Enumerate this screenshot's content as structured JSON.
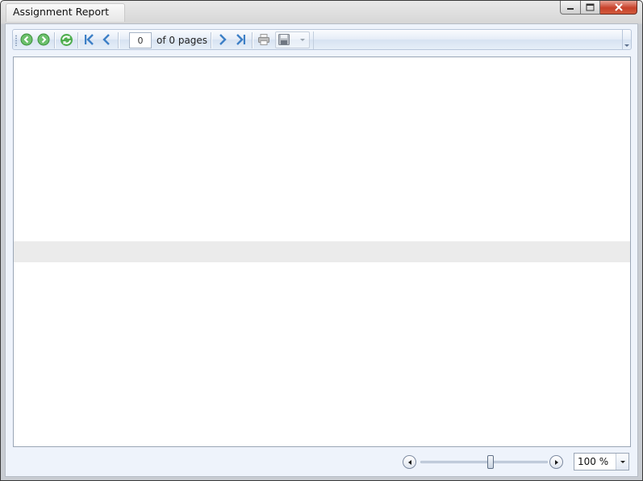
{
  "window": {
    "title": "Assignment Report"
  },
  "toolbar": {
    "buttons": [
      {
        "name": "back",
        "icon": "arrow-left-icon"
      },
      {
        "name": "forward",
        "icon": "arrow-right-icon"
      },
      {
        "name": "refresh",
        "icon": "refresh-icon"
      },
      {
        "name": "first-page",
        "icon": "first-page-icon"
      },
      {
        "name": "previous-page",
        "icon": "chevron-left-icon"
      },
      {
        "name": "next-page",
        "icon": "chevron-right-icon"
      },
      {
        "name": "last-page",
        "icon": "last-page-icon"
      },
      {
        "name": "print",
        "icon": "printer-icon"
      },
      {
        "name": "save",
        "icon": "floppy-disk-icon"
      }
    ],
    "page_input_value": "0",
    "page_of_text": "of 0 pages"
  },
  "zoom": {
    "value_text": "100 %",
    "slider_fraction": 0.5
  },
  "colors": {
    "accent_green": "#3aa23a",
    "accent_blue": "#3c7fc6",
    "close_red": "#c7412a"
  }
}
